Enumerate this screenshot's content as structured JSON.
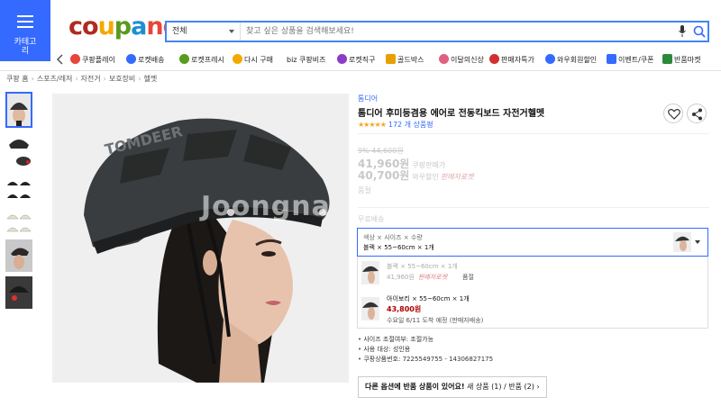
{
  "header": {
    "category_label": "카테고리",
    "logo": [
      "co",
      "u",
      "p",
      "a",
      "ng"
    ],
    "search": {
      "scope": "전체",
      "placeholder": "찾고 싶은 상품을 검색해보세요!"
    },
    "quicknav": [
      {
        "label": "쿠팡플레이",
        "icon": "play-icon",
        "color": "#e8443a"
      },
      {
        "label": "로켓배송",
        "icon": "rocket-icon",
        "color": "#346aff"
      },
      {
        "label": "로켓프레시",
        "icon": "rocket-fresh-icon",
        "color": "#5a9a1e"
      },
      {
        "label": "다시 구매",
        "icon": "repurchase-icon",
        "color": "#f2a900"
      },
      {
        "label": "biz 쿠팡비즈",
        "icon": "biz-icon",
        "color": "#222222"
      },
      {
        "label": "로켓직구",
        "icon": "rocket-global-icon",
        "color": "#8a3cc8"
      },
      {
        "label": "골드박스",
        "icon": "gold-box-icon",
        "color": "#e8a000"
      },
      {
        "label": "이달의신상",
        "icon": "new-icon",
        "color": "#e06080"
      },
      {
        "label": "판매자특가",
        "icon": "seller-icon",
        "color": "#d03030"
      },
      {
        "label": "와우회원할인",
        "icon": "wow-icon",
        "color": "#346aff"
      },
      {
        "label": "이벤트/쿠폰",
        "icon": "event-icon",
        "color": "#346aff"
      },
      {
        "label": "반품마켓",
        "icon": "return-market-icon",
        "color": "#2a8a3a"
      }
    ]
  },
  "breadcrumb": [
    "쿠팡 홈",
    "스포츠/레저",
    "자전거",
    "보호장비",
    "헬멧"
  ],
  "product": {
    "brand": "톰디어",
    "title": "톰디어 후미등겸용 에어로 전동킥보드 자전거헬멧",
    "rating_count": "172 개 상품평",
    "old_price": "9% 44,600원",
    "price1": "41,960원",
    "price1_note": "쿠팡판매가",
    "price2": "40,700원",
    "price2_note": "와우할인",
    "rocket_label": "판매자로켓",
    "soldout": "품절",
    "free_shipping": "무료배송",
    "watermark": "Joongna"
  },
  "option_select": {
    "line1": "색상 × 사이즈 × 수량",
    "line2": "블랙 × 55~60cm × 1개"
  },
  "options": [
    {
      "name": "블랙 × 55~60cm × 1개",
      "price": "41,960원",
      "rocket": "판매자로켓",
      "status": "품절"
    },
    {
      "name": "아이보리 × 55~60cm × 1개",
      "price": "43,800원",
      "delivery": "수요일 6/11 도착 예정 (판매자배송)"
    }
  ],
  "details": [
    "사이즈 조절여부: 조절가능",
    "사용 대상: 성인용",
    "쿠팡상품번호: 7225549755 - 14306827175"
  ],
  "other_options": {
    "lead": "다른 옵션에 반품 상품이 있어요!",
    "rest": " 새 상품 (1) / 반품 (2) "
  },
  "colors": {
    "accent": "#346aff",
    "price_red": "#ae0000",
    "star": "#f5a623"
  }
}
